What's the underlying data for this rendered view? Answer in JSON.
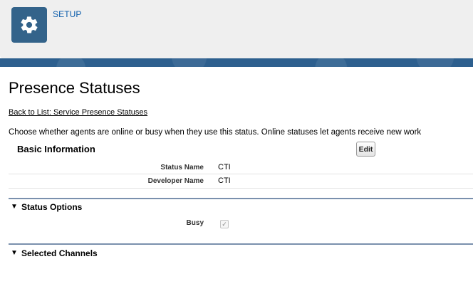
{
  "header": {
    "app_label": "SETUP",
    "icon": "gear-icon",
    "icon_bg_color": "#33638a"
  },
  "page": {
    "title": "Presence Statuses",
    "back_link": "Back to List: Service Presence Statuses",
    "description": "Choose whether agents are online or busy when they use this status. Online statuses let agents receive new work"
  },
  "basic_information": {
    "title": "Basic Information",
    "edit_label": "Edit",
    "fields": [
      {
        "label": "Status Name",
        "value": "CTI"
      },
      {
        "label": "Developer Name",
        "value": "CTI"
      }
    ]
  },
  "status_options": {
    "title": "Status Options",
    "twisty": "▼",
    "busy_label": "Busy",
    "busy_checked_glyph": "✓"
  },
  "selected_channels": {
    "title": "Selected Channels",
    "twisty": "▼"
  },
  "colors": {
    "accent_band": "#2d5f8e",
    "section_rule": "#7a90ad",
    "link_blue": "#0b5cab"
  }
}
